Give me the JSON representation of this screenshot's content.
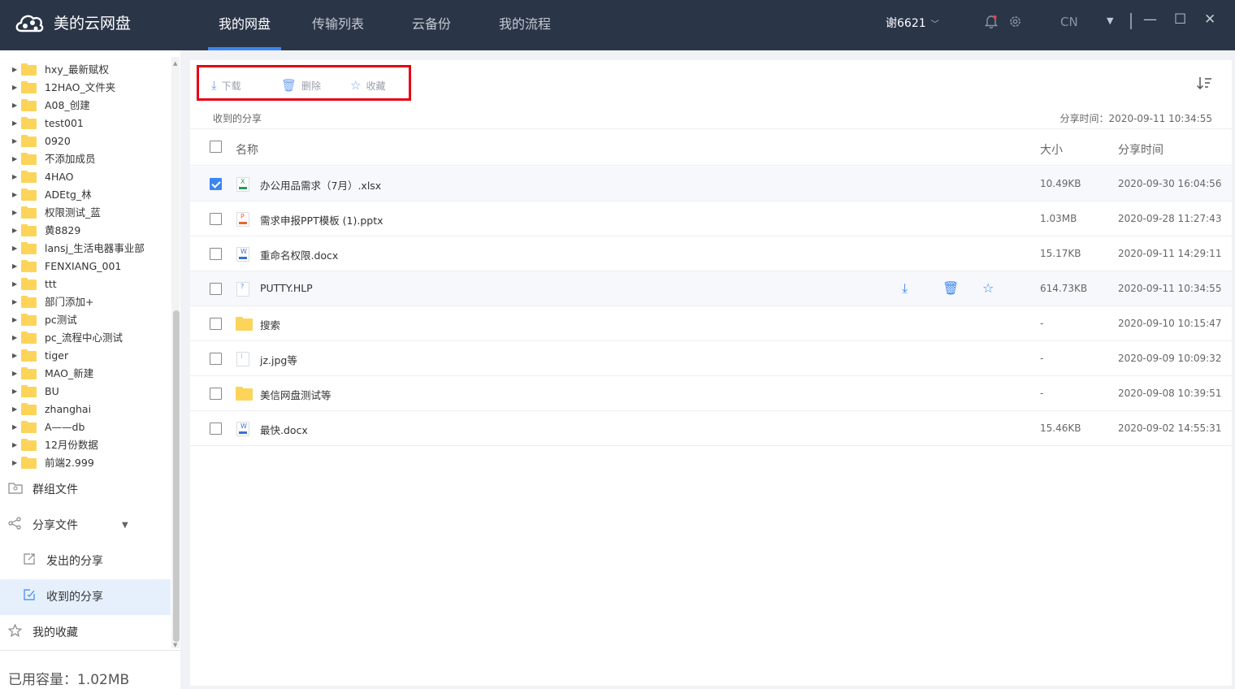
{
  "app": {
    "name": "美的云网盘"
  },
  "nav": {
    "tabs": [
      "我的网盘",
      "传输列表",
      "云备份",
      "我的流程"
    ],
    "active": 0
  },
  "header": {
    "user": "谢6621",
    "lang": "CN"
  },
  "sidebar": {
    "folders": [
      "hxy_最新赋权",
      "12HAO_文件夹",
      "A08_创建",
      "test001",
      "0920",
      "不添加成员",
      "4HAO",
      "ADEtg_林",
      "权限测试_蓝",
      "黄8829",
      "lansj_生活电器事业部",
      "FENXIANG_001",
      "ttt",
      "部门添加+",
      "pc测试",
      "pc_流程中心测试",
      "tiger",
      "MAO_新建",
      "BU",
      "zhanghai",
      "A——db",
      "12月份数据",
      "前端2.999"
    ],
    "group_files": "群组文件",
    "share_files": "分享文件",
    "sent_shares": "发出的分享",
    "received_shares": "收到的分享",
    "favorites": "我的收藏",
    "usage": "已用容量：1.02MB"
  },
  "toolbar": {
    "download": "下载",
    "delete": "删除",
    "favorite": "收藏"
  },
  "main": {
    "breadcrumb": "收到的分享",
    "share_time": "分享时间：2020-09-11 10:34:55"
  },
  "table": {
    "headers": {
      "name": "名称",
      "size": "大小",
      "time": "分享时间"
    },
    "rows": [
      {
        "name": "办公用品需求（7月）.xlsx",
        "size": "10.49KB",
        "time": "2020-09-30 16:04:56",
        "type": "xlsx",
        "checked": true
      },
      {
        "name": "需求申报PPT模板 (1).pptx",
        "size": "1.03MB",
        "time": "2020-09-28 11:27:43",
        "type": "pptx",
        "checked": false
      },
      {
        "name": "重命名权限.docx",
        "size": "15.17KB",
        "time": "2020-09-11 14:29:11",
        "type": "docx",
        "checked": false
      },
      {
        "name": "PUTTY.HLP",
        "size": "614.73KB",
        "time": "2020-09-11 10:34:55",
        "type": "hlp",
        "checked": false
      },
      {
        "name": "搜索",
        "size": "-",
        "time": "2020-09-10 10:15:47",
        "type": "folder",
        "checked": false
      },
      {
        "name": "jz.jpg等",
        "size": "-",
        "time": "2020-09-09 10:09:32",
        "type": "multi",
        "checked": false
      },
      {
        "name": "美信网盘测试等",
        "size": "-",
        "time": "2020-09-08 10:39:51",
        "type": "folder",
        "checked": false
      },
      {
        "name": "最快.docx",
        "size": "15.46KB",
        "time": "2020-09-02 14:55:31",
        "type": "docx",
        "checked": false
      }
    ]
  },
  "colors": {
    "header_bg": "#2b3548",
    "accent": "#3b86f5",
    "highlight_box": "#e60012",
    "folder": "#fcd45a"
  }
}
